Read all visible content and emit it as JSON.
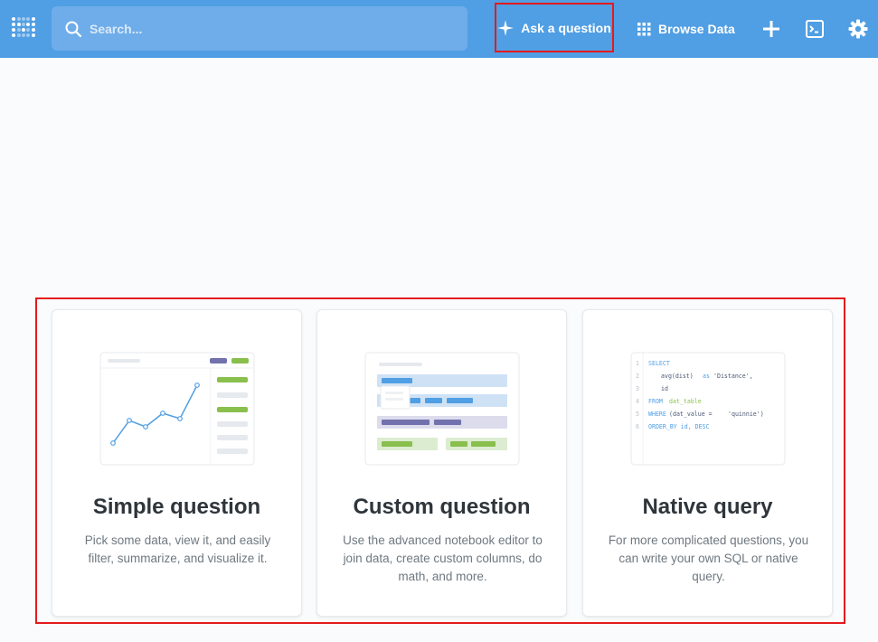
{
  "nav": {
    "search_placeholder": "Search...",
    "ask_label": "Ask a question",
    "browse_label": "Browse Data",
    "icons": [
      "metabase-logo-icon",
      "search-icon",
      "sparkle-icon",
      "grid-icon",
      "plus-icon",
      "terminal-icon",
      "gear-icon"
    ]
  },
  "cards": [
    {
      "title": "Simple question",
      "description": "Pick some data, view it, and easily filter, summarize, and visualize it."
    },
    {
      "title": "Custom question",
      "description": "Use the advanced notebook editor to join data, create custom columns, do math, and more."
    },
    {
      "title": "Native query",
      "description": "For more complicated questions, you can write your own SQL or native query."
    }
  ],
  "sql_sample": {
    "line_numbers": [
      "1",
      "2",
      "3",
      "4",
      "5",
      "6"
    ],
    "line1": "SELECT",
    "line2_fn": "avg(dist)",
    "line2_as": "as",
    "line2_str": "'Distance',",
    "line3": "id",
    "line4_kw": "FROM",
    "line4_tbl": "dat_table",
    "line5_kw": "WHERE",
    "line5_cond": "(dat_value =",
    "line5_str": "'quinnie')",
    "line6": "ORDER_BY id, DESC"
  },
  "colors": {
    "nav_bg": "#509ee3",
    "highlight_border": "#e41a1c",
    "green": "#88bf4d",
    "purple": "#7172ad",
    "blue": "#509ee3"
  }
}
